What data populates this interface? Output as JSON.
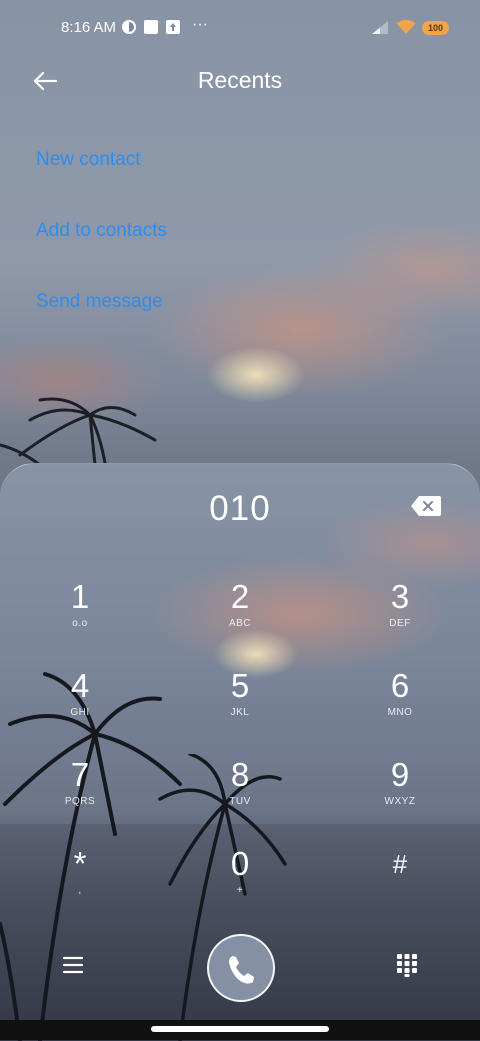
{
  "status_bar": {
    "time": "8:16 AM",
    "overflow": "···",
    "battery": "100",
    "icons": [
      "vpn-icon",
      "notification-square-icon",
      "upload-icon",
      "signal-icon",
      "wifi-icon"
    ]
  },
  "header": {
    "title": "Recents",
    "back_icon": "back-arrow-icon"
  },
  "actions": {
    "new_contact": "New contact",
    "add_to_contacts": "Add to contacts",
    "send_message": "Send message"
  },
  "dialer": {
    "number": "010",
    "keys": [
      {
        "digit": "1",
        "letters": "ᴏ.ᴏ"
      },
      {
        "digit": "2",
        "letters": "ABC"
      },
      {
        "digit": "3",
        "letters": "DEF"
      },
      {
        "digit": "4",
        "letters": "GHI"
      },
      {
        "digit": "5",
        "letters": "JKL"
      },
      {
        "digit": "6",
        "letters": "MNO"
      },
      {
        "digit": "7",
        "letters": "PQRS"
      },
      {
        "digit": "8",
        "letters": "TUV"
      },
      {
        "digit": "9",
        "letters": "WXYZ"
      },
      {
        "digit": "*",
        "letters": ","
      },
      {
        "digit": "0",
        "letters": "+"
      },
      {
        "digit": "#",
        "letters": ""
      }
    ]
  },
  "colors": {
    "accent": "#2d8cf0",
    "battery": "#f0a54a",
    "call_button": "#8590a4"
  }
}
